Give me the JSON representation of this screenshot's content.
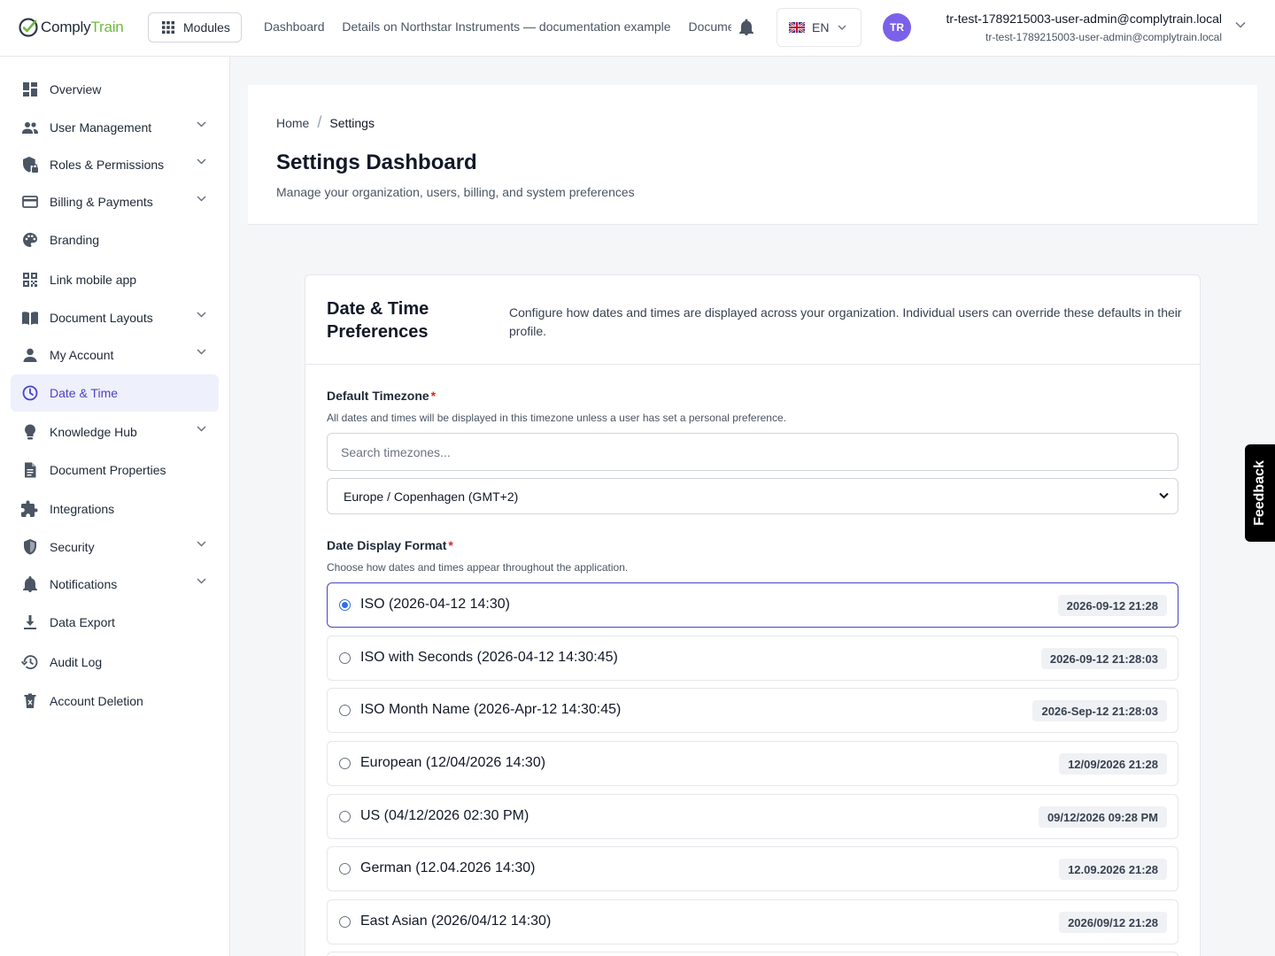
{
  "brand": {
    "name_a": "Comply",
    "name_b": "Train",
    "accent": "#4c44c4",
    "green": "#6dbb3d"
  },
  "topbar": {
    "modules_label": "Modules",
    "nav": [
      "Dashboard",
      "Details on Northstar Instruments — documentation example",
      "Documents"
    ],
    "language": "EN",
    "avatar_initials": "TR",
    "user_name": "tr-test-1789215003-user-admin@complytrain.local",
    "user_email": "tr-test-1789215003-user-admin@complytrain.local"
  },
  "sidebar": {
    "items": [
      {
        "label": "Overview",
        "icon": "dashboard-icon",
        "chevron": false
      },
      {
        "label": "User Management",
        "icon": "people-icon",
        "chevron": true
      },
      {
        "label": "Roles & Permissions",
        "icon": "shield-lock-icon",
        "chevron": true
      },
      {
        "label": "Billing & Payments",
        "icon": "credit-card-icon",
        "chevron": true
      },
      {
        "label": "Branding",
        "icon": "palette-icon",
        "chevron": false
      },
      {
        "label": "Link mobile app",
        "icon": "qr-code-icon",
        "chevron": false
      },
      {
        "label": "Document Layouts",
        "icon": "book-icon",
        "chevron": true
      },
      {
        "label": "My Account",
        "icon": "person-icon",
        "chevron": true
      },
      {
        "label": "Date & Time",
        "icon": "clock-icon",
        "chevron": false,
        "active": true
      },
      {
        "label": "Knowledge Hub",
        "icon": "lightbulb-icon",
        "chevron": true
      },
      {
        "label": "Document Properties",
        "icon": "document-icon",
        "chevron": false
      },
      {
        "label": "Integrations",
        "icon": "puzzle-icon",
        "chevron": false
      },
      {
        "label": "Security",
        "icon": "shield-icon",
        "chevron": true
      },
      {
        "label": "Notifications",
        "icon": "bell-icon",
        "chevron": true
      },
      {
        "label": "Data Export",
        "icon": "download-icon",
        "chevron": false
      },
      {
        "label": "Audit Log",
        "icon": "history-icon",
        "chevron": false
      },
      {
        "label": "Account Deletion",
        "icon": "trash-icon",
        "chevron": false
      }
    ]
  },
  "header": {
    "breadcrumb": [
      "Home",
      "Settings"
    ],
    "title": "Settings Dashboard",
    "subtitle": "Manage your organization, users, billing, and system preferences"
  },
  "card": {
    "title": "Date & Time Preferences",
    "description": "Configure how dates and times are displayed across your organization. Individual users can override these defaults in their profile.",
    "timezone": {
      "label": "Default Timezone",
      "required_mark": "*",
      "help": "All dates and times will be displayed in this timezone unless a user has set a personal preference.",
      "search_placeholder": "Search timezones...",
      "selected": "Europe / Copenhagen (GMT+2)"
    },
    "format": {
      "label": "Date Display Format",
      "required_mark": "*",
      "help": "Choose how dates and times appear throughout the application.",
      "options": [
        {
          "label": "ISO (2026-04-12 14:30)",
          "preview": "2026-09-12 21:28",
          "selected": true
        },
        {
          "label": "ISO with Seconds (2026-04-12 14:30:45)",
          "preview": "2026-09-12 21:28:03"
        },
        {
          "label": "ISO Month Name (2026-Apr-12 14:30:45)",
          "preview": "2026-Sep-12 21:28:03"
        },
        {
          "label": "European (12/04/2026 14:30)",
          "preview": "12/09/2026 21:28"
        },
        {
          "label": "US (04/12/2026 02:30 PM)",
          "preview": "09/12/2026 09:28 PM"
        },
        {
          "label": "German (12.04.2026 14:30)",
          "preview": "12.09.2026 21:28"
        },
        {
          "label": "East Asian (2026/04/12 14:30)",
          "preview": "2026/09/12 21:28"
        }
      ]
    }
  },
  "feedback_label": "Feedback"
}
